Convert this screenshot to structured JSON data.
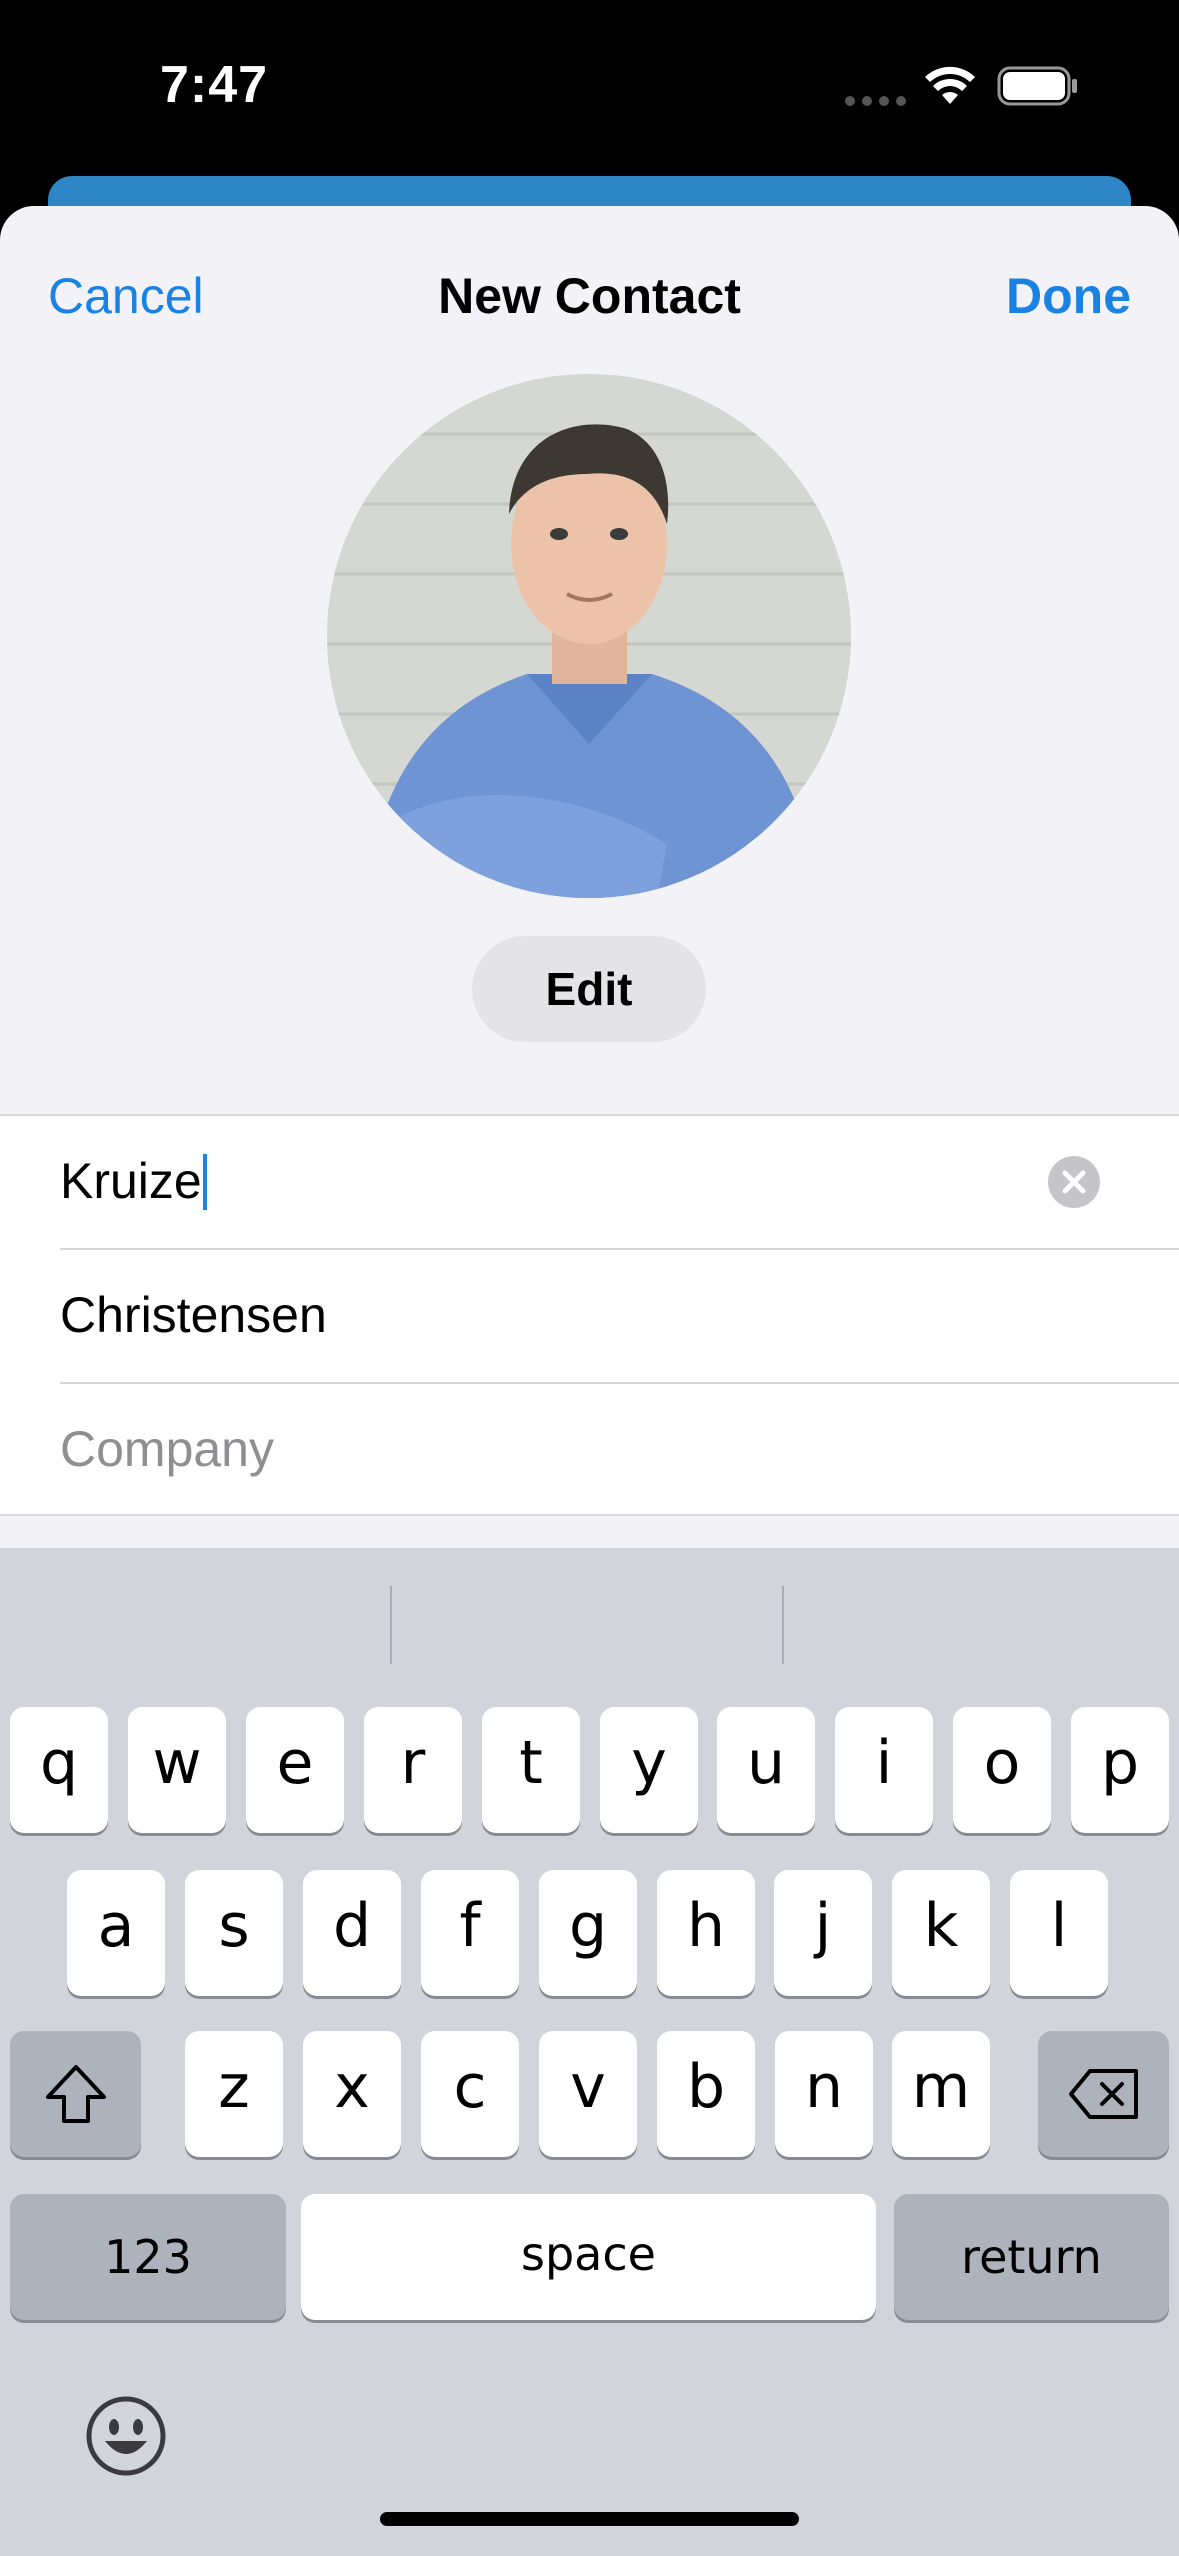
{
  "status_bar": {
    "time": "7:47"
  },
  "nav": {
    "cancel": "Cancel",
    "title": "New Contact",
    "done": "Done"
  },
  "photo": {
    "edit_label": "Edit"
  },
  "form": {
    "first_name": "Kruize",
    "last_name": "Christensen",
    "company_placeholder": "Company"
  },
  "keyboard": {
    "row1": [
      "q",
      "w",
      "e",
      "r",
      "t",
      "y",
      "u",
      "i",
      "o",
      "p"
    ],
    "row2": [
      "a",
      "s",
      "d",
      "f",
      "g",
      "h",
      "j",
      "k",
      "l"
    ],
    "row3": [
      "z",
      "x",
      "c",
      "v",
      "b",
      "n",
      "m"
    ],
    "numbers_label": "123",
    "space_label": "space",
    "return_label": "return"
  },
  "colors": {
    "accent": "#1a82e2",
    "sheet_bg": "#f2f2f7",
    "keyboard_bg": "#d1d4db"
  }
}
